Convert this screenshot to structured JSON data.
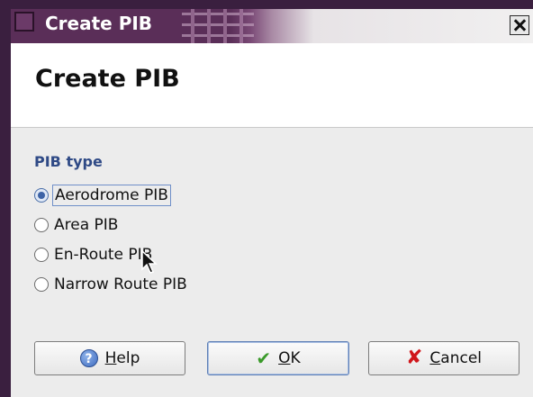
{
  "window": {
    "title": "Create PIB"
  },
  "header": {
    "title": "Create PIB"
  },
  "pib_type": {
    "label": "PIB type",
    "options": [
      {
        "label": "Aerodrome PIB",
        "checked": true
      },
      {
        "label": "Area PIB",
        "checked": false
      },
      {
        "label": "En-Route PIB",
        "checked": false
      },
      {
        "label": "Narrow Route PIB",
        "checked": false
      }
    ]
  },
  "buttons": {
    "help": {
      "mnemonic": "H",
      "rest": "elp",
      "icon": "help-icon"
    },
    "ok": {
      "mnemonic": "O",
      "rest": "K",
      "icon": "checkmark-icon"
    },
    "cancel": {
      "mnemonic": "C",
      "rest": "ancel",
      "icon": "cancel-x-icon"
    }
  },
  "colors": {
    "titlebar": "#5a2e58",
    "section_label": "#2f4a86",
    "body_bg": "#ececec"
  }
}
